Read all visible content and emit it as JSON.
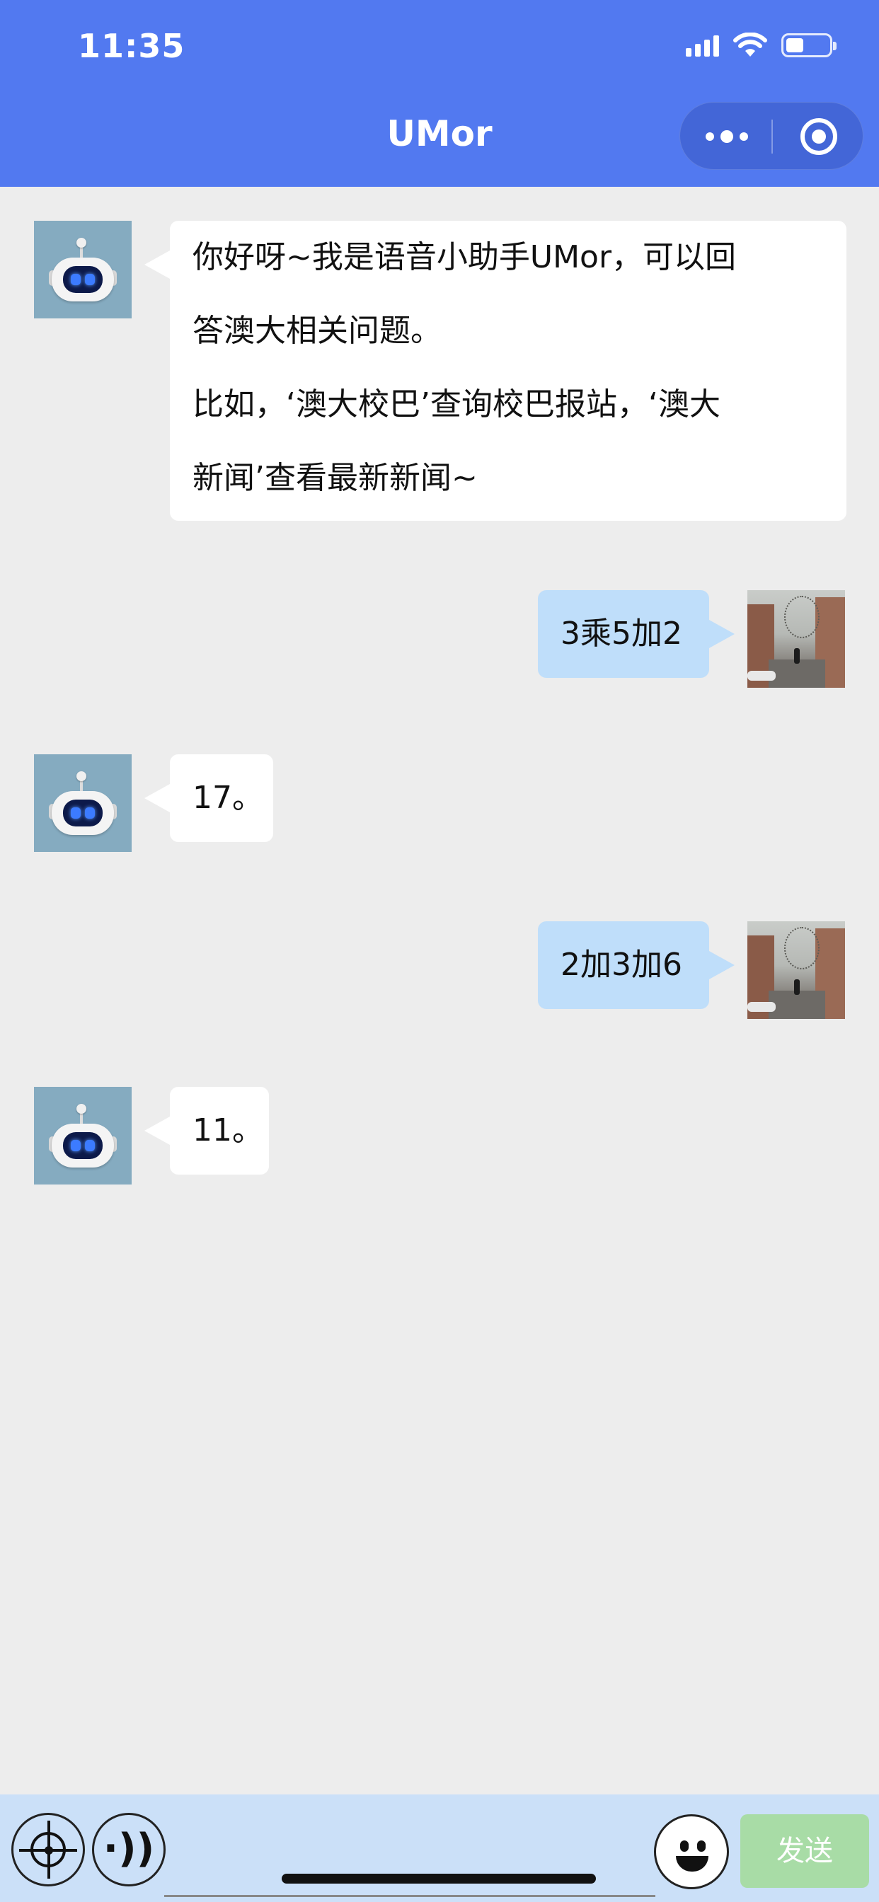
{
  "status_bar": {
    "time": "11:35"
  },
  "nav": {
    "title": "UMor"
  },
  "messages": [
    {
      "side": "bot",
      "lines": [
        "你好呀~我是语音小助手UMor，可以回",
        "答澳大相关问题。",
        "比如，‘澳大校巴’查询校巴报站，‘澳大",
        "新闻’查看最新新闻~"
      ]
    },
    {
      "side": "user",
      "text": "3乘5加2"
    },
    {
      "side": "bot",
      "text": "17。"
    },
    {
      "side": "user",
      "text": "2加3加6"
    },
    {
      "side": "bot",
      "text": "11。"
    }
  ],
  "bottom_bar": {
    "send_label": "发送",
    "voice_icon_glyph": "·))"
  },
  "colors": {
    "header": "#5279f0",
    "chat_bg": "#ededed",
    "user_bubble": "#bfdefa",
    "bottom_bar": "#cbe0f8",
    "send_button": "#a8dca6"
  }
}
